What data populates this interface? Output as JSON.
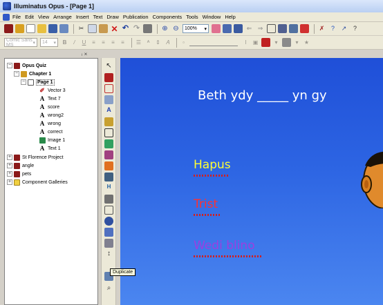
{
  "window": {
    "title": "Illuminatus Opus - [Page 1]"
  },
  "menu": [
    "File",
    "Edit",
    "View",
    "Arrange",
    "Insert",
    "Text",
    "Draw",
    "Publication",
    "Components",
    "Tools",
    "Window",
    "Help"
  ],
  "toolbar": {
    "zoom": "100%"
  },
  "format_toolbar": {
    "font": "Comic Sans MS",
    "size": "14"
  },
  "tree": {
    "root": "Opus Quiz",
    "chapter": "Chapter 1",
    "page": "Page 1",
    "objects": [
      "Vector 3",
      "Text 7",
      "score",
      "wrong2",
      "wrong",
      "correct",
      "Image 1",
      "Text 1"
    ],
    "others": [
      "St Florence Project",
      "angle",
      "pets",
      "Component Galleries"
    ]
  },
  "slide": {
    "question": "Beth ydy _____ yn gy",
    "answers": [
      {
        "text": "Hapus",
        "color": "#ffff33"
      },
      {
        "text": "Trist",
        "color": "#ff3030"
      },
      {
        "text": "Wedi blino",
        "color": "#9b3fe0"
      }
    ]
  },
  "tooltip": "Duplicate",
  "colors": {
    "canvas_top": "#1f4fd8",
    "canvas_bottom": "#4b86f0"
  }
}
